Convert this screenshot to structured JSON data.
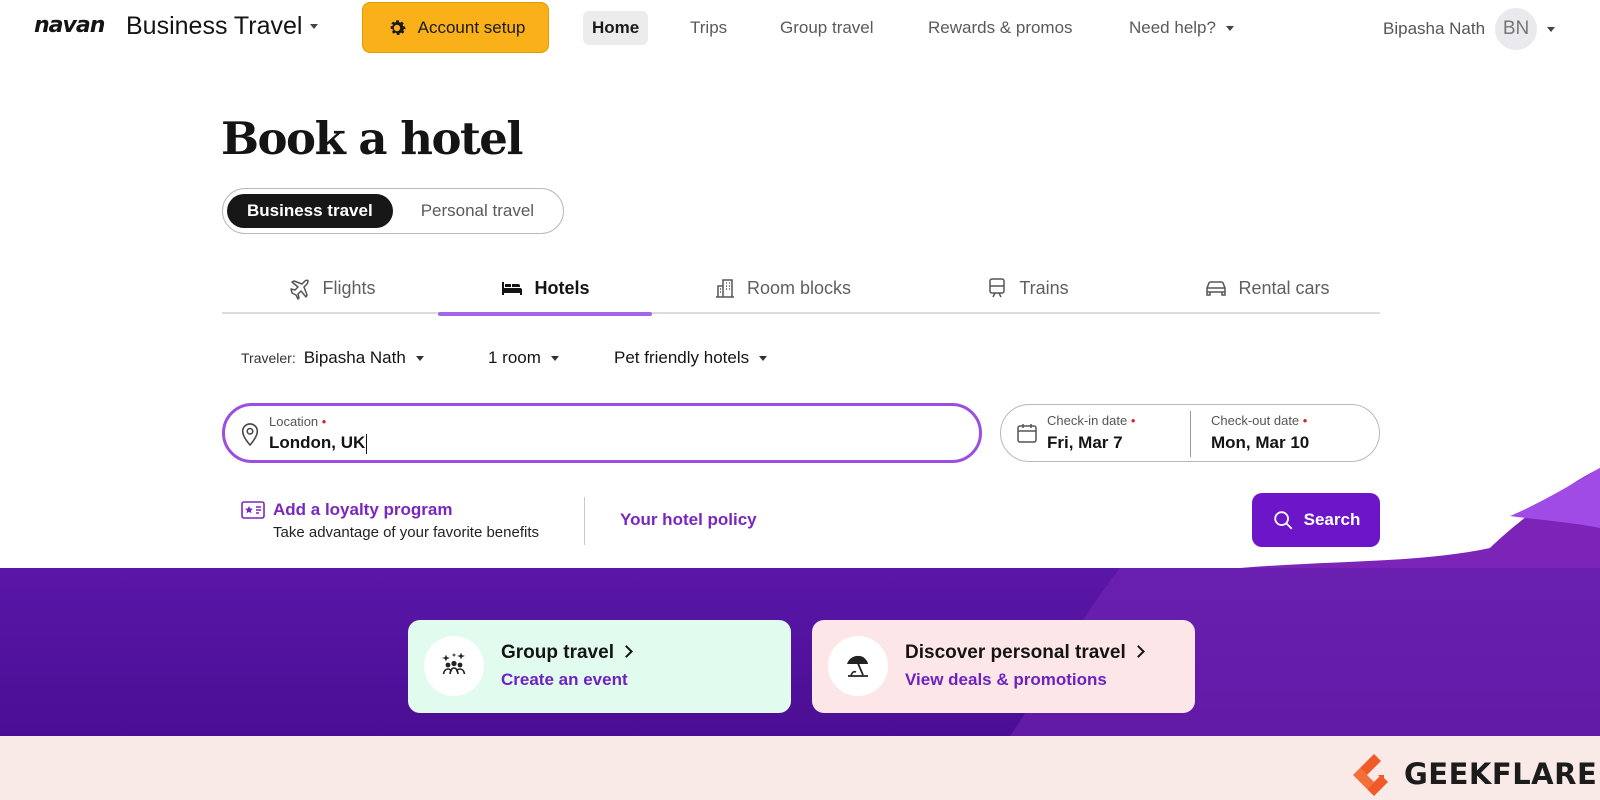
{
  "header": {
    "logo_text": "NAVAN",
    "product_name": "Business Travel",
    "account_setup_label": "Account setup",
    "nav": [
      {
        "label": "Home",
        "active": true
      },
      {
        "label": "Trips"
      },
      {
        "label": "Group travel"
      },
      {
        "label": "Rewards & promos"
      },
      {
        "label": "Need help?"
      }
    ],
    "user_name": "Bipasha Nath",
    "user_initials": "BN"
  },
  "page": {
    "title": "Book a hotel",
    "travel_type": {
      "options": [
        "Business travel",
        "Personal travel"
      ],
      "selected": "Business travel"
    },
    "tabs": [
      {
        "label": "Flights",
        "icon": "plane-icon"
      },
      {
        "label": "Hotels",
        "icon": "bed-icon",
        "active": true
      },
      {
        "label": "Room blocks",
        "icon": "buildings-icon"
      },
      {
        "label": "Trains",
        "icon": "train-icon"
      },
      {
        "label": "Rental cars",
        "icon": "car-icon"
      }
    ]
  },
  "search": {
    "traveler_label": "Traveler:",
    "traveler_value": "Bipasha Nath",
    "rooms": "1 room",
    "filter": "Pet friendly hotels",
    "location_label": "Location",
    "location_value": "London, UK",
    "checkin_label": "Check-in date",
    "checkin_value": "Fri, Mar 7",
    "checkout_label": "Check-out date",
    "checkout_value": "Mon, Mar 10",
    "loyalty_title": "Add a loyalty program",
    "loyalty_sub": "Take advantage of your favorite benefits",
    "policy_label": "Your hotel policy",
    "search_label": "Search"
  },
  "promos": [
    {
      "title": "Group travel",
      "subtitle": "Create an event",
      "icon": "group-icon"
    },
    {
      "title": "Discover personal travel",
      "subtitle": "View deals & promotions",
      "icon": "beach-umbrella-icon"
    }
  ],
  "watermark": {
    "text": "GEEKFLARE"
  },
  "colors": {
    "accent": "#6c15c9",
    "account_setup": "#f9b019",
    "band": "#5a16a8",
    "group_card": "#e1fbef",
    "personal_card": "#fde6e8",
    "strip": "#f9e9e7"
  }
}
